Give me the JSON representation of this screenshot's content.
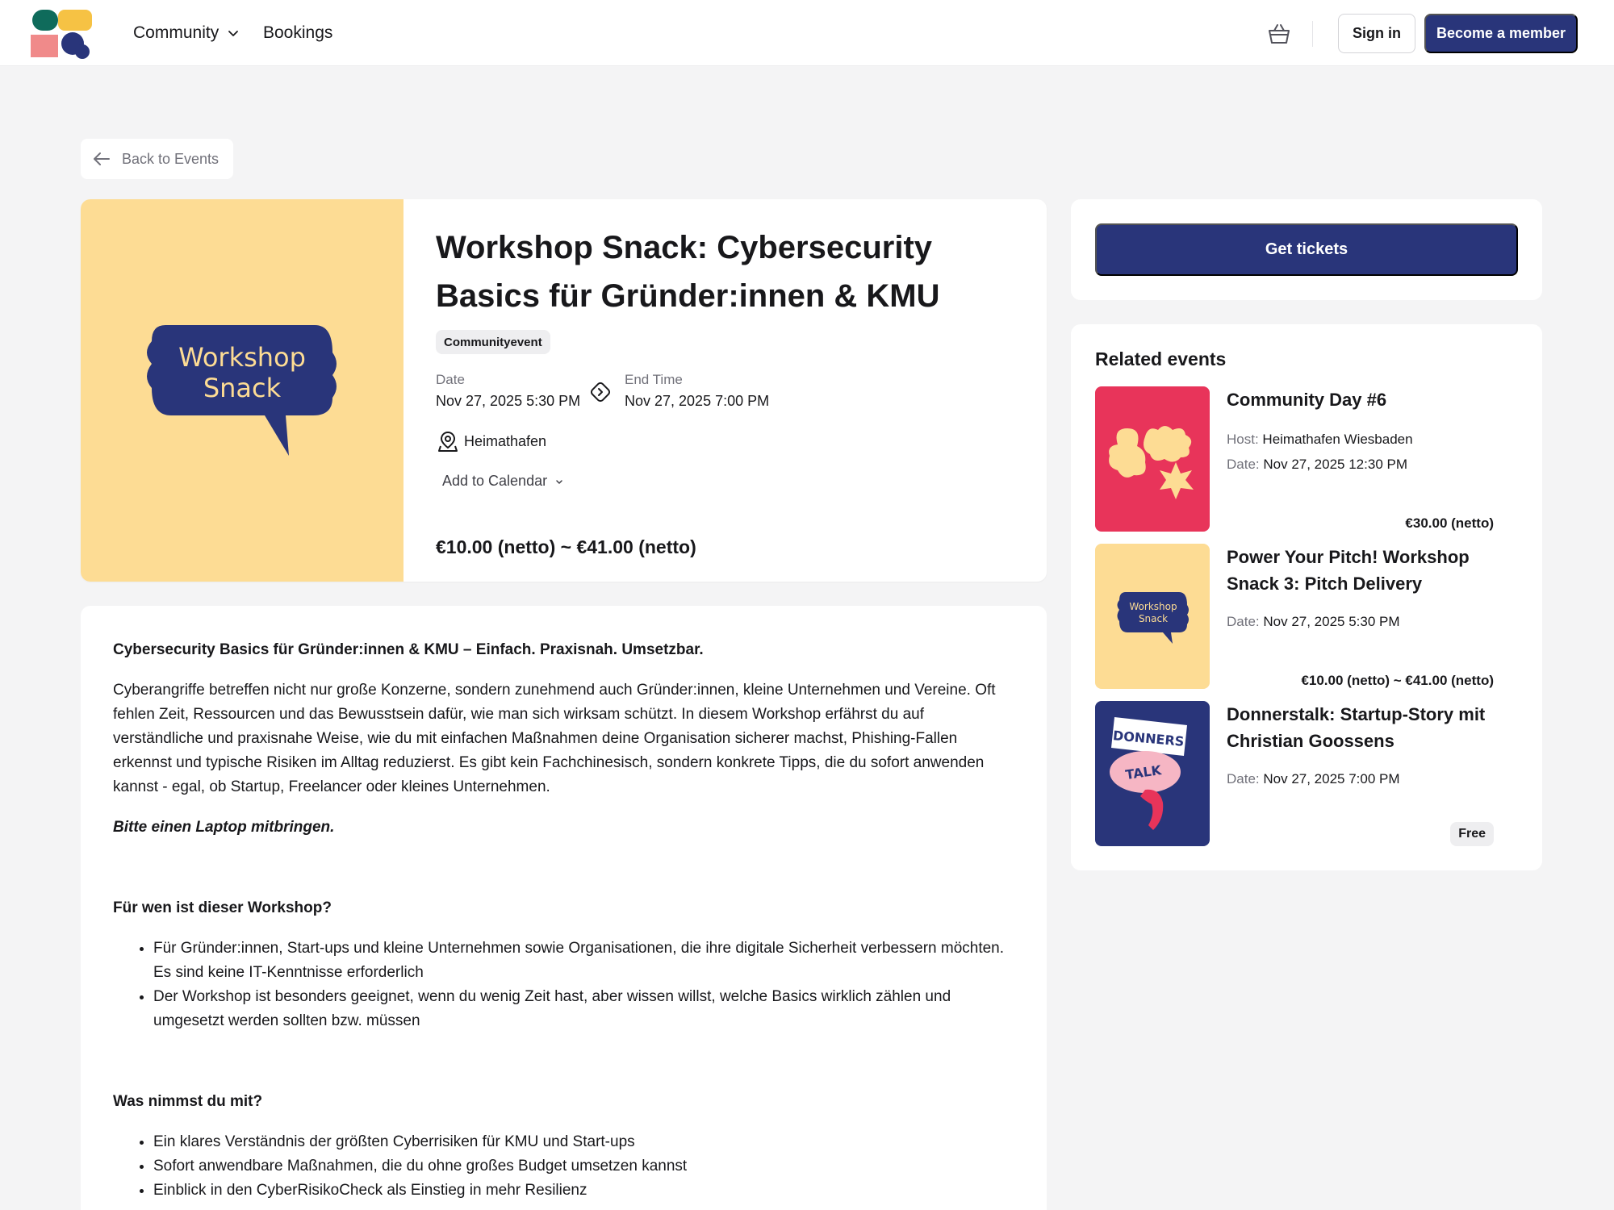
{
  "nav": {
    "community_label": "Community",
    "bookings_label": "Bookings",
    "signin_label": "Sign in",
    "member_label": "Become a member"
  },
  "back_label": "Back to Events",
  "event": {
    "title": "Workshop Snack: Cybersecurity Basics für Gründer:innen & KMU",
    "art_line1": "Workshop",
    "art_line2": "Snack",
    "badge": "Communityevent",
    "date_label": "Date",
    "date_value": "Nov 27, 2025 5:30 PM",
    "end_label": "End Time",
    "end_value": "Nov 27, 2025 7:00 PM",
    "location": "Heimathafen",
    "add_calendar": "Add to Calendar",
    "price": "€10.00 (netto) ~ €41.00 (netto)"
  },
  "description": {
    "heading": "Cybersecurity Basics für Gründer:innen & KMU – Einfach. Praxisnah. Umsetzbar.",
    "intro": "Cyberangriffe betreffen nicht nur große Konzerne, sondern zunehmend auch Gründer:innen, kleine Unternehmen und Vereine. Oft fehlen Zeit, Ressourcen und das Bewusstsein dafür, wie man sich wirksam schützt. In diesem Workshop erfährst du auf verständliche und praxisnahe Weise, wie du mit einfachen Maßnahmen deine Organisation sicherer machst, Phishing-Fallen erkennst und typische Risiken im Alltag reduzierst. Es gibt kein Fachchinesisch, sondern konkrete Tipps, die du sofort anwenden kannst - egal, ob Startup, Freelancer oder kleines Unternehmen.",
    "laptop_note": "Bitte einen Laptop mitbringen.",
    "who_heading": "Für wen ist dieser Workshop?",
    "who_items": [
      "Für Gründer:innen, Start-ups und kleine Unternehmen sowie Organisationen, die ihre digitale Sicherheit verbessern möchten. Es sind keine IT-Kenntnisse erforderlich",
      "Der Workshop ist besonders geeignet, wenn du wenig Zeit hast, aber wissen willst, welche Basics wirklich zählen und umgesetzt werden sollten bzw. müssen"
    ],
    "takeaway_heading": "Was nimmst du mit?",
    "takeaway_items": [
      "Ein klares Verständnis der größten Cyberrisiken für KMU und Start-ups",
      "Sofort anwendbare Maßnahmen, die du ohne großes Budget umsetzen kannst",
      "Einblick in den CyberRisikoCheck als Einstieg in mehr Resilienz"
    ]
  },
  "tickets_label": "Get tickets",
  "related": {
    "title": "Related events",
    "items": [
      {
        "name": "Community Day #6",
        "host_key": "Host:",
        "host_value": "Heimathafen Wiesbaden",
        "date_key": "Date:",
        "date_value": "Nov 27, 2025 12:30 PM",
        "price": "€30.00 (netto)"
      },
      {
        "name": "Power Your Pitch! Workshop Snack 3: Pitch Delivery",
        "date_key": "Date:",
        "date_value": "Nov 27, 2025 5:30 PM",
        "price": "€10.00 (netto) ~ €41.00 (netto)",
        "art_line1": "Workshop",
        "art_line2": "Snack"
      },
      {
        "name": "Donnerstalk: Startup-Story mit Christian Goossens",
        "date_key": "Date:",
        "date_value": "Nov 27, 2025 7:00 PM",
        "price": "Free",
        "art_line1": "DONNERS",
        "art_line2": "TALK"
      }
    ]
  },
  "colors": {
    "brand_navy": "#29357a",
    "art_yellow": "#fddc94",
    "art_pink": "#e8345a"
  }
}
